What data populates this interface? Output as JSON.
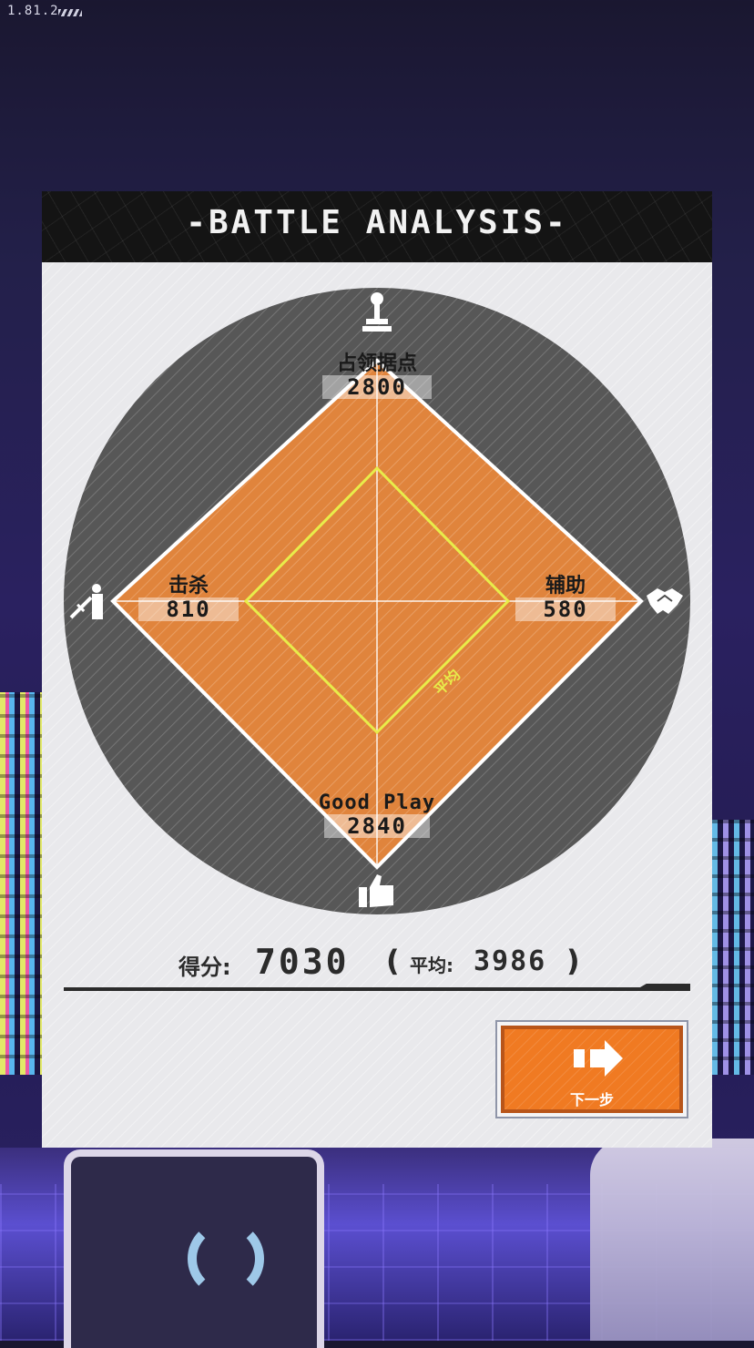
{
  "app": {
    "version": "1.81.2"
  },
  "panel": {
    "title": "-BATTLE ANALYSIS-"
  },
  "radar": {
    "axes": [
      {
        "name": "占领据点",
        "value": "2800",
        "icon": "flag-capture-icon",
        "position": "top"
      },
      {
        "name": "辅助",
        "value": "580",
        "icon": "handshake-icon",
        "position": "right"
      },
      {
        "name": "Good Play",
        "value": "2840",
        "icon": "thumbs-up-icon",
        "position": "bottom"
      },
      {
        "name": "击杀",
        "value": "810",
        "icon": "sword-fighter-icon",
        "position": "left"
      }
    ],
    "average_tag": "平均",
    "colors": {
      "fill": "#f0893a",
      "outline": "#ffffff",
      "average_outline": "#e8ec4a",
      "disc": "#4a4a4a"
    }
  },
  "score": {
    "label": "得分:",
    "value": "7030",
    "paren_open": "(",
    "average_label": "平均:",
    "average_value": "3986",
    "paren_close": ")"
  },
  "next_button": {
    "label": "下一步",
    "icon": "arrow-right-icon",
    "color": "#f07a22"
  }
}
